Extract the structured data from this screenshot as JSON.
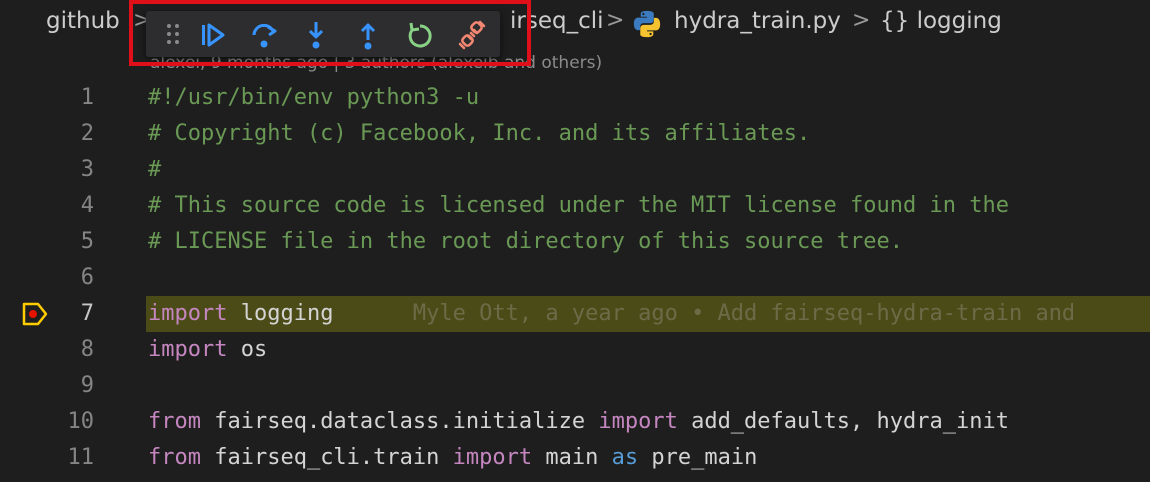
{
  "breadcrumb": {
    "items": [
      "github",
      "irseq_cli",
      "hydra_train.py",
      "{} logging"
    ],
    "separator": ">"
  },
  "blame": {
    "meta_text": "alexei, 9 months ago | 3 authors (alexeib and others)"
  },
  "debug_toolbar": {
    "buttons": [
      {
        "name": "continue",
        "icon": "continue-icon"
      },
      {
        "name": "step-over",
        "icon": "step-over-icon"
      },
      {
        "name": "step-into",
        "icon": "step-into-icon"
      },
      {
        "name": "step-out",
        "icon": "step-out-icon"
      },
      {
        "name": "restart",
        "icon": "restart-icon"
      },
      {
        "name": "disconnect",
        "icon": "disconnect-icon"
      }
    ],
    "colors": {
      "blue": "#3794ff",
      "green": "#89d185",
      "red": "#f48771",
      "highlight_box": "#e0101a"
    }
  },
  "editor": {
    "current_line": 7,
    "lines": [
      {
        "n": "1",
        "parts": [
          {
            "t": "#!/usr/bin/env python3 -u",
            "c": "cm"
          }
        ]
      },
      {
        "n": "2",
        "parts": [
          {
            "t": "# Copyright (c) Facebook, Inc. and its affiliates.",
            "c": "cm"
          }
        ]
      },
      {
        "n": "3",
        "parts": [
          {
            "t": "#",
            "c": "cm"
          }
        ]
      },
      {
        "n": "4",
        "parts": [
          {
            "t": "# This source code is licensed under the MIT license found in the",
            "c": "cm"
          }
        ]
      },
      {
        "n": "5",
        "parts": [
          {
            "t": "# LICENSE file in the root directory of this source tree.",
            "c": "cm"
          }
        ]
      },
      {
        "n": "6",
        "parts": []
      },
      {
        "n": "7",
        "parts": [
          {
            "t": "import",
            "c": "kw"
          },
          {
            "t": " logging",
            "c": "tx"
          },
          {
            "t": "      Myle Ott, a year ago • Add fairseq-hydra-train and",
            "c": "blame-inline"
          }
        ]
      },
      {
        "n": "8",
        "parts": [
          {
            "t": "import",
            "c": "kw"
          },
          {
            "t": " os",
            "c": "tx"
          }
        ]
      },
      {
        "n": "9",
        "parts": []
      },
      {
        "n": "10",
        "parts": [
          {
            "t": "from",
            "c": "kw"
          },
          {
            "t": " fairseq.dataclass.initialize ",
            "c": "tx"
          },
          {
            "t": "import",
            "c": "kw"
          },
          {
            "t": " add_defaults, hydra_init",
            "c": "tx"
          }
        ]
      },
      {
        "n": "11",
        "parts": [
          {
            "t": "from",
            "c": "kw"
          },
          {
            "t": " fairseq_cli.train ",
            "c": "tx"
          },
          {
            "t": "import",
            "c": "kw"
          },
          {
            "t": " main ",
            "c": "tx"
          },
          {
            "t": "as",
            "c": "kw2"
          },
          {
            "t": " pre_main",
            "c": "tx"
          }
        ]
      }
    ]
  }
}
